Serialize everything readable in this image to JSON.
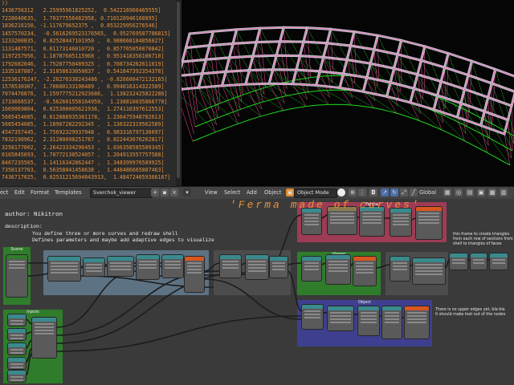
{
  "text_editor": {
    "lines": [
      "))",
      "1436756312   2.25995961825252,  0.542216960465555]",
      "7228040635,  1.70377556482958, 0.710120946168895]",
      "1836216150, -1.117679652375 ,  0.853229956276546]",
      "1457570234,  -0.5616269523176565,  0.952769587786815]",
      "1233200835,  0.02528447101950 ,  0.988668184856027]",
      "1131487571,  0.61173146010720 ,  0.857765050070842]",
      "1197257956,  1.18787605115968 ,  0.951418356100710]",
      "1792682046,  1.75287750489325 ,  0.708734262611019]",
      "1335187887,  2.31058633050837 ,  0.541847392354378]",
      "1253617624?, -2.26276338243486 , -0.826600472132165]",
      "",
      "1578530307,  1.70600133106489 ,  0.994016314322589]",
      "7074476876,  1.1597775212923686,  1.138232425822286]",
      "1733666537,  -0.562601558164950,  1.238810035866770]",
      "1669069804,  0.025300005621936,  1.274110397612553]",
      "5665454085,  0.612888935301178,  1.236475948782613]",
      "5665454085,  1.18967282292345 ,  1.136322319562589]",
      "4547357445,  1.75692329937048 ,  0.983316797136097]",
      "7832190962,  2.31280098251787 ,  0.822443076202817]",
      "3258177002,  2.26423334296453 ,  1.036358585589345]",
      "0165845093,  1.70772138524057 ,  1.204913557757588]",
      "",
      "8467235565,  1.14116342862447 ,  1.348399976589925]",
      "7358137703,  0.56358841458638 ,  1.448486665887463]",
      "7436717025,  0.02531215694643913,  1.484724059366167]"
    ]
  },
  "viewport": {
    "background": "#050505",
    "shell_color": "#bfc3cc",
    "grid_color": "#ff40a0",
    "green_curve_color": "#1fd51f"
  },
  "header": {
    "left_menu": [
      "ect",
      "Edit",
      "Format",
      "Templates"
    ],
    "tree_name": "Sverchok_viewer",
    "right_menu": [
      "View",
      "Select",
      "Add",
      "Object"
    ],
    "mode": "Object Mode",
    "pivot": "Global"
  },
  "node_editor": {
    "title": "'Ferma made of curves'",
    "author": "author: Nikitron",
    "description_label": "description:",
    "description": [
      "You define three or more curves and redraw shell",
      "Defines parameters and maybe add adaptive edges to visualize"
    ],
    "frames": [
      {
        "label": "Scene"
      },
      {
        "label": ""
      },
      {
        "label": "Inputs"
      },
      {
        "label": "Ferma"
      },
      {
        "label": "Viewer"
      },
      {
        "label": ""
      },
      {
        "label": "Object"
      },
      {
        "label": ""
      }
    ],
    "notes": [
      "this frame to create triangles",
      "from each row of sections from",
      "shell to triangles of faces",
      "There is no upper edges yet, bla bla",
      "it should make text out of the nodes"
    ],
    "colors": {
      "frame_blue": "#5d7283",
      "frame_green": "#2f7d2b",
      "frame_pink": "#9e3b55",
      "frame_indigo": "#3f3f8f",
      "frame_grey": "#4c4c4c",
      "frame_brown": "#8b7a4e",
      "node_header_teal": "#3a8a8d",
      "node_orange": "#d9561f"
    }
  }
}
